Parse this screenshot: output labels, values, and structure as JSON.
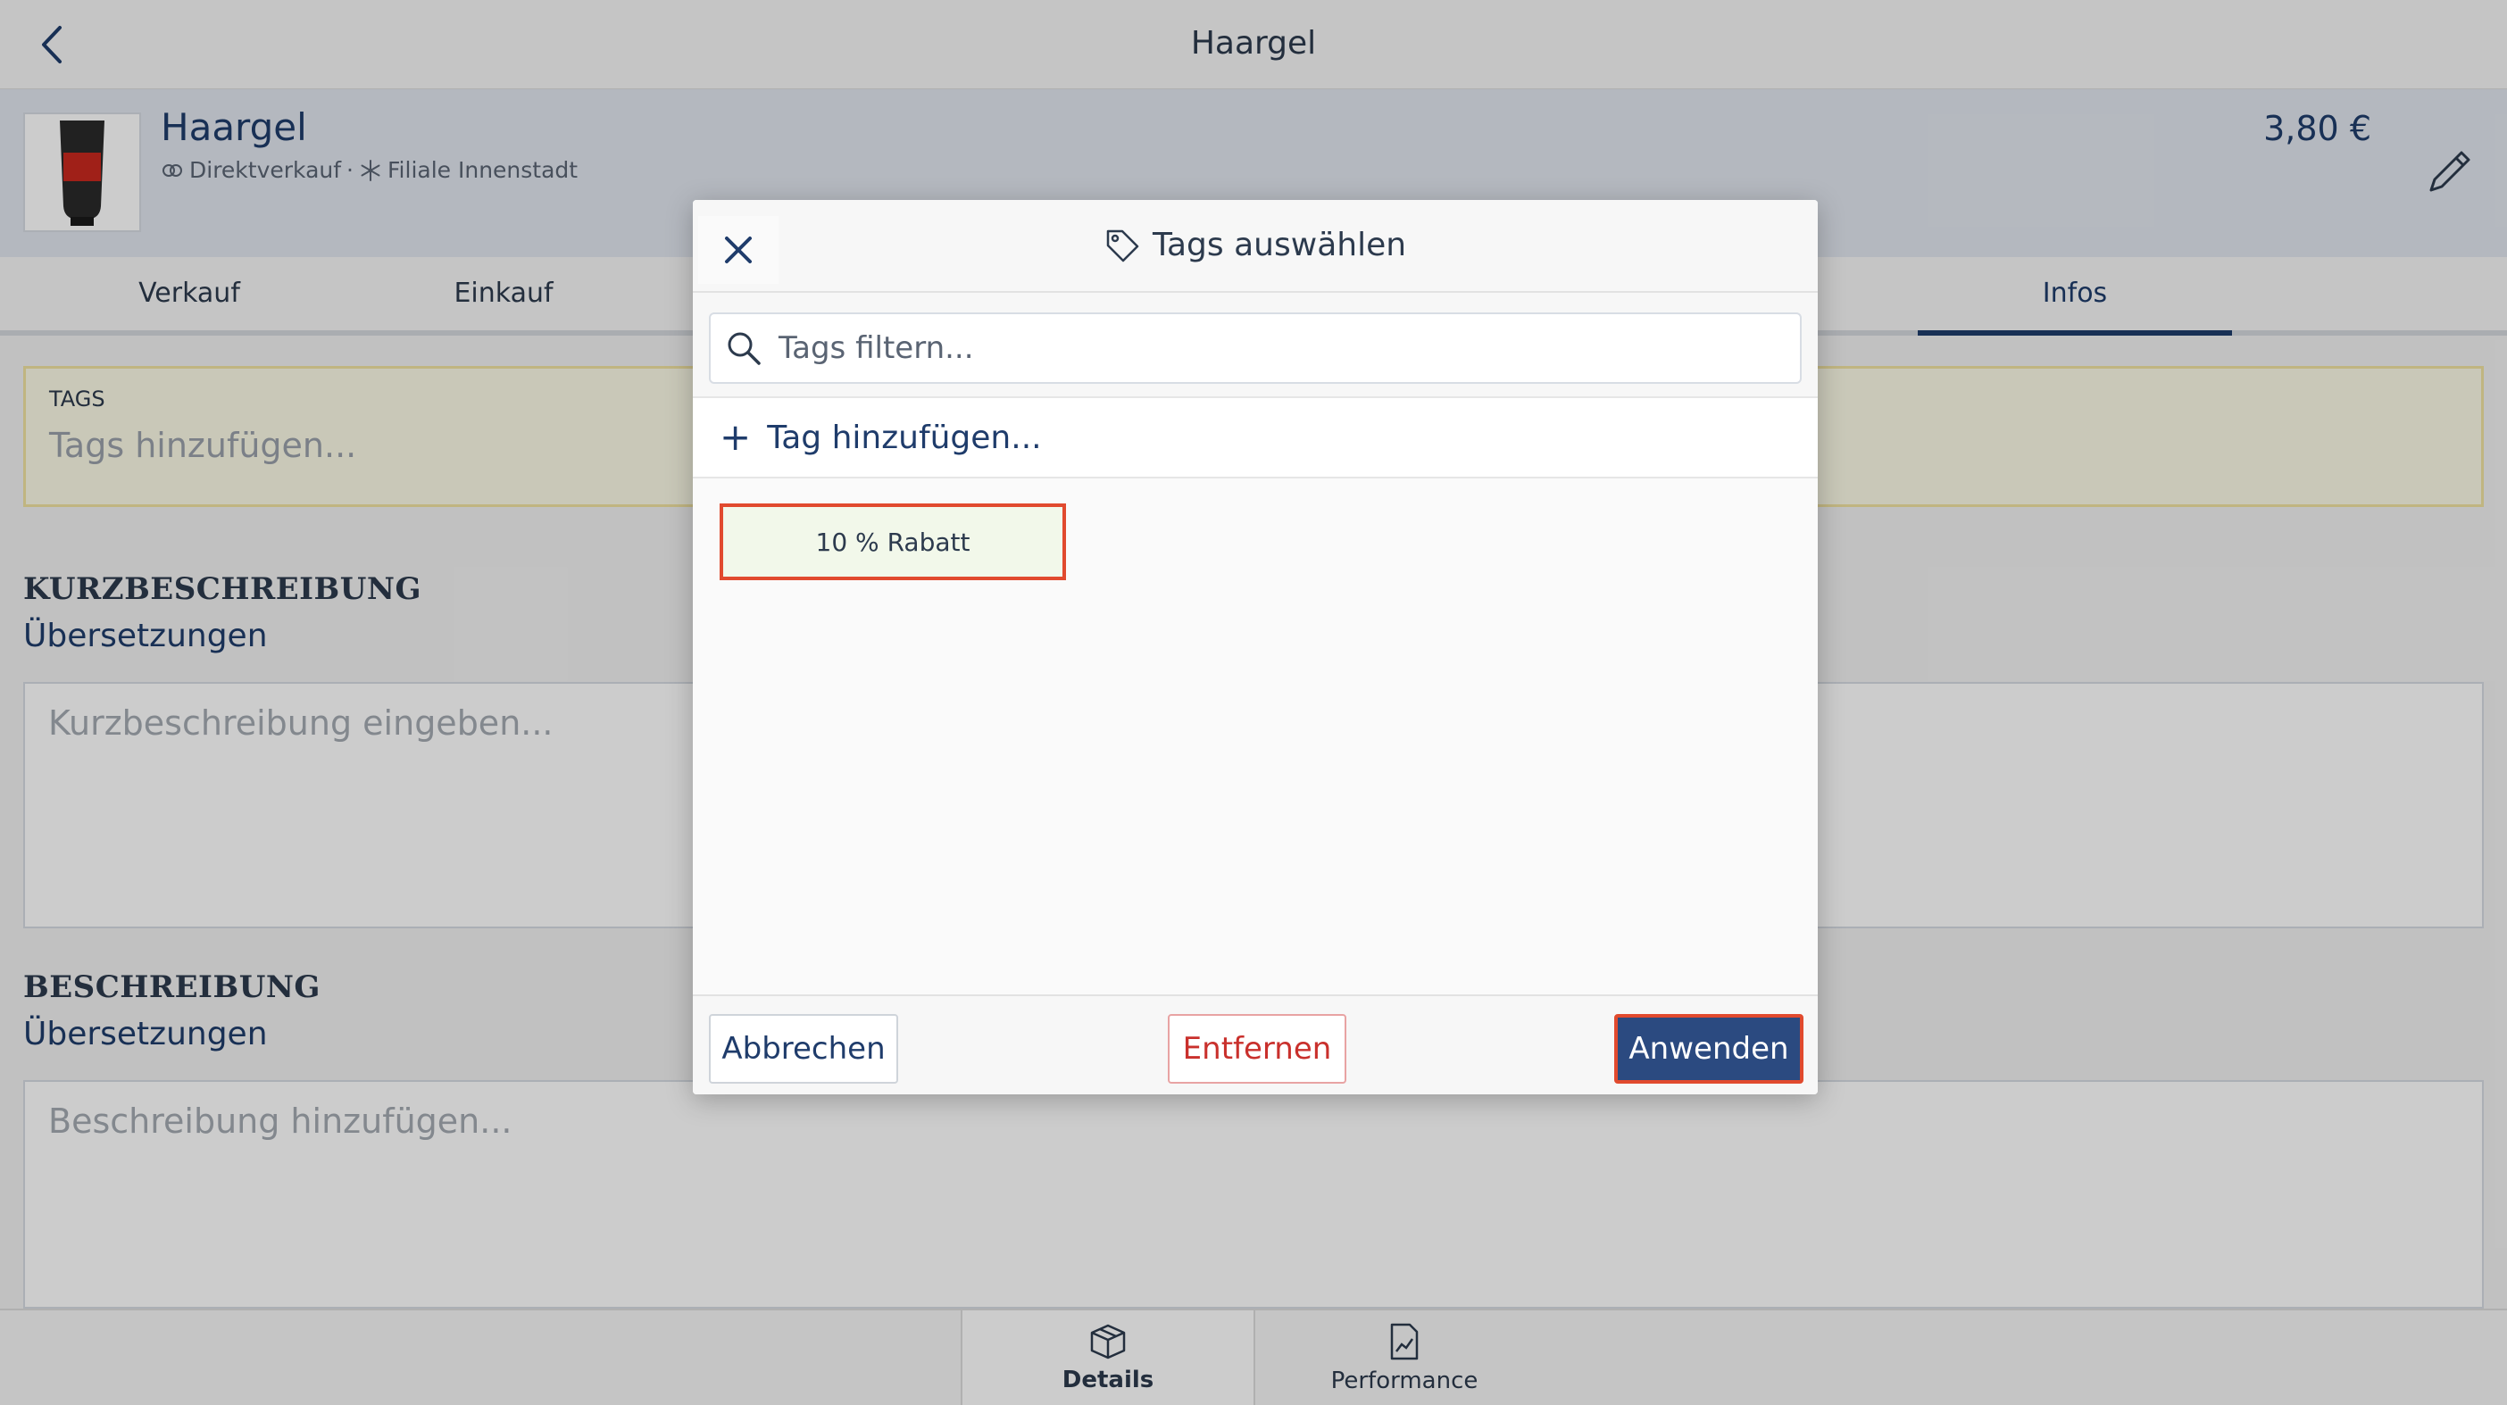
{
  "header": {
    "title": "Haargel",
    "back_icon": "chevron-left-icon"
  },
  "product": {
    "name": "Haargel",
    "sale_type": "Direktverkauf",
    "separator": "·",
    "branch": "Filiale Innenstadt",
    "price": "3,80 €"
  },
  "tabs": [
    {
      "label": "Verkauf"
    },
    {
      "label": "Einkauf"
    },
    {
      "label": ""
    },
    {
      "label": ""
    },
    {
      "label": ""
    },
    {
      "label": ""
    },
    {
      "label": "Infos",
      "active": true
    }
  ],
  "tags_section": {
    "label": "TAGS",
    "placeholder": "Tags hinzufügen..."
  },
  "short_description": {
    "heading": "KURZBESCHREIBUNG",
    "link": "Übersetzungen",
    "placeholder": "Kurzbeschreibung eingeben..."
  },
  "description": {
    "heading": "BESCHREIBUNG",
    "link": "Übersetzungen",
    "placeholder": "Beschreibung hinzufügen..."
  },
  "bottom_nav": [
    {
      "label": "Details",
      "icon": "box-icon",
      "active": true
    },
    {
      "label": "Performance",
      "icon": "chart-document-icon",
      "active": false
    }
  ],
  "modal": {
    "title": "Tags auswählen",
    "title_icon": "tag-icon",
    "close_icon": "close-icon",
    "filter_placeholder": "Tags filtern...",
    "add_tag_label": "Tag hinzufügen...",
    "add_tag_icon": "+",
    "tags": [
      {
        "label": "10 % Rabatt",
        "selected": true
      }
    ],
    "buttons": {
      "cancel": "Abbrechen",
      "remove": "Entfernen",
      "apply": "Anwenden"
    }
  },
  "colors": {
    "primary": "#1f3c6b",
    "apply_button": "#2b4a80",
    "highlight_border": "#e14a2e",
    "remove_text": "#c9302c",
    "tags_box_bg": "#fcfbe6"
  }
}
